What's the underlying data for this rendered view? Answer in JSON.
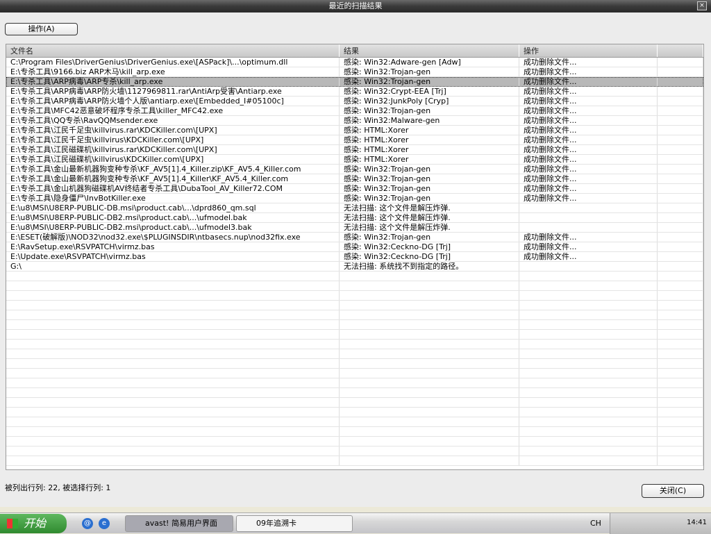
{
  "window": {
    "title": "最近的扫描结果",
    "close": "×"
  },
  "toolbar": {
    "action_label": "操作(A)"
  },
  "table": {
    "headers": [
      "文件名",
      "结果",
      "操作"
    ],
    "selected_index": 2,
    "rows": [
      [
        "C:\\Program Files\\DriverGenius\\DriverGenius.exe\\[ASPack]\\...\\optimum.dll",
        "感染: Win32:Adware-gen [Adw]",
        "成功删除文件..."
      ],
      [
        "E:\\专杀工具\\9166.biz ARP木马\\kill_arp.exe",
        "感染: Win32:Trojan-gen",
        "成功删除文件..."
      ],
      [
        "E:\\专杀工具\\ARP病毒\\ARP专杀\\kill_arp.exe",
        "感染: Win32:Trojan-gen",
        "成功删除文件..."
      ],
      [
        "E:\\专杀工具\\ARP病毒\\ARP防火墙\\1127969811.rar\\AntiArp受害\\Antiarp.exe",
        "感染: Win32:Crypt-EEA [Trj]",
        "成功删除文件..."
      ],
      [
        "E:\\专杀工具\\ARP病毒\\ARP防火墙个人版\\antiarp.exe\\[Embedded_I#05100c]",
        "感染: Win32:JunkPoly [Cryp]",
        "成功删除文件..."
      ],
      [
        "E:\\专杀工具\\MFC42恶意破坏程序专杀工具\\killer_MFC42.exe",
        "感染: Win32:Trojan-gen",
        "成功删除文件..."
      ],
      [
        "E:\\专杀工具\\QQ专杀\\RavQQMsender.exe",
        "感染: Win32:Malware-gen",
        "成功删除文件..."
      ],
      [
        "E:\\专杀工具\\江民千足虫\\killvirus.rar\\KDCKiller.com\\[UPX]",
        "感染: HTML:Xorer",
        "成功删除文件..."
      ],
      [
        "E:\\专杀工具\\江民千足虫\\killvirus\\KDCKiller.com\\[UPX]",
        "感染: HTML:Xorer",
        "成功删除文件..."
      ],
      [
        "E:\\专杀工具\\江民磁碟机\\killvirus.rar\\KDCKiller.com\\[UPX]",
        "感染: HTML:Xorer",
        "成功删除文件..."
      ],
      [
        "E:\\专杀工具\\江民磁碟机\\killvirus\\KDCKiller.com\\[UPX]",
        "感染: HTML:Xorer",
        "成功删除文件..."
      ],
      [
        "E:\\专杀工具\\金山最新机器狗变种专杀\\KF_AV5[1].4_Killer.zip\\KF_AV5.4_Killer.com",
        "感染: Win32:Trojan-gen",
        "成功删除文件..."
      ],
      [
        "E:\\专杀工具\\金山最新机器狗变种专杀\\KF_AV5[1].4_Killer\\KF_AV5.4_Killer.com",
        "感染: Win32:Trojan-gen",
        "成功删除文件..."
      ],
      [
        "E:\\专杀工具\\金山机器狗磁碟机AV终结者专杀工具\\DubaTool_AV_Killer72.COM",
        "感染: Win32:Trojan-gen",
        "成功删除文件..."
      ],
      [
        "E:\\专杀工具\\隐身僵尸\\InvBotKiller.exe",
        "感染: Win32:Trojan-gen",
        "成功删除文件..."
      ],
      [
        "E:\\u8\\MSI\\U8ERP-PUBLIC-DB.msi\\product.cab\\...\\dprd860_qm.sql",
        "无法扫描: 这个文件是解压炸弹.",
        ""
      ],
      [
        "E:\\u8\\MSI\\U8ERP-PUBLIC-DB2.msi\\product.cab\\...\\ufmodel.bak",
        "无法扫描: 这个文件是解压炸弹.",
        ""
      ],
      [
        "E:\\u8\\MSI\\U8ERP-PUBLIC-DB2.msi\\product.cab\\...\\ufmodel3.bak",
        "无法扫描: 这个文件是解压炸弹.",
        ""
      ],
      [
        "E:\\ESET(破解版)\\NOD32\\nod32.exe\\$PLUGINSDIR\\ntbasecs.nup\\nod32fix.exe",
        "感染: Win32:Trojan-gen",
        "成功删除文件..."
      ],
      [
        "E:\\RavSetup.exe\\RSVPATCH\\virmz.bas",
        "感染: Win32:Ceckno-DG [Trj]",
        "成功删除文件..."
      ],
      [
        "E:\\Update.exe\\RSVPATCH\\virmz.bas",
        "感染: Win32:Ceckno-DG [Trj]",
        "成功删除文件..."
      ],
      [
        "G:\\",
        "无法扫描: 系统找不到指定的路径。",
        ""
      ]
    ]
  },
  "status": "被列出行列: 22, 被选择行列: 1",
  "close_button": "关闭(C)",
  "taskbar": {
    "start": "开始",
    "tasks": [
      "avast! 简易用户界面",
      "09年追溯卡"
    ],
    "lang": "CH",
    "clock": "14:41"
  }
}
